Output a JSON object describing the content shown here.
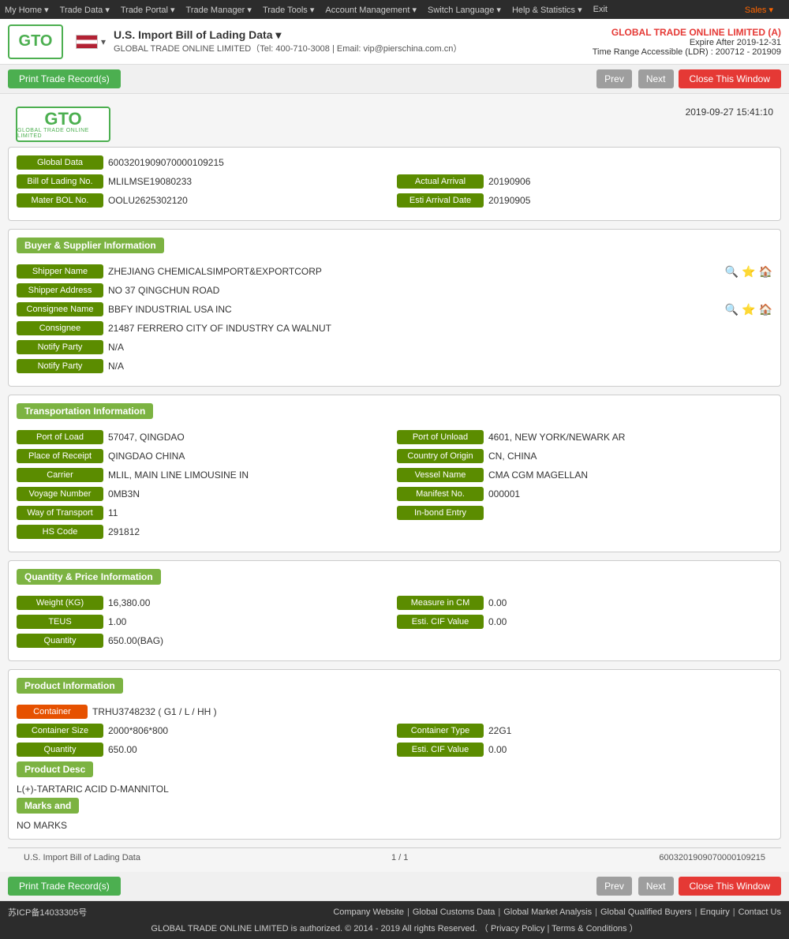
{
  "topnav": {
    "items": [
      "My Home ▾",
      "Trade Data ▾",
      "Trade Portal ▾",
      "Trade Manager ▾",
      "Trade Tools ▾",
      "Account Management ▾",
      "Switch Language ▾",
      "Help & Statistics ▾",
      "Exit"
    ],
    "sales": "Sales ▾"
  },
  "header": {
    "logo_text": "GTO",
    "logo_sub": "GLOBAL TRADE ONLINE LIMITED",
    "title": "U.S. Import Bill of Lading Data  ▾",
    "contact": "GLOBAL TRADE ONLINE LIMITED（Tel: 400-710-3008 | Email: vip@pierschina.com.cn）",
    "company": "GLOBAL TRADE ONLINE LIMITED (A)",
    "expire": "Expire After 2019-12-31",
    "time_range": "Time Range Accessible (LDR) : 200712 - 201909"
  },
  "toolbar": {
    "print_label": "Print Trade Record(s)",
    "prev_label": "Prev",
    "next_label": "Next",
    "close_label": "Close This Window"
  },
  "report": {
    "logo_text": "GTO",
    "logo_sub": "GLOBAL TRADE ONLINE LIMITED",
    "datetime": "2019-09-27 15:41:10",
    "global_data_label": "Global Data",
    "global_data_value": "6003201909070000109215",
    "bol_label": "Bill of Lading No.",
    "bol_value": "MLILMSE19080233",
    "actual_arrival_label": "Actual Arrival",
    "actual_arrival_value": "20190906",
    "mater_bol_label": "Mater BOL No.",
    "mater_bol_value": "OOLU2625302120",
    "esti_arrival_label": "Esti Arrival Date",
    "esti_arrival_value": "20190905",
    "buyer_supplier_header": "Buyer & Supplier Information",
    "shipper_name_label": "Shipper Name",
    "shipper_name_value": "ZHEJIANG CHEMICALSIMPORT&EXPORTCORP",
    "shipper_addr_label": "Shipper Address",
    "shipper_addr_value": "NO 37 QINGCHUN ROAD",
    "consignee_name_label": "Consignee Name",
    "consignee_name_value": "BBFY INDUSTRIAL USA INC",
    "consignee_label": "Consignee",
    "consignee_value": "21487 FERRERO CITY OF INDUSTRY CA WALNUT",
    "notify_party1_label": "Notify Party",
    "notify_party1_value": "N/A",
    "notify_party2_label": "Notify Party",
    "notify_party2_value": "N/A",
    "transport_header": "Transportation Information",
    "port_load_label": "Port of Load",
    "port_load_value": "57047, QINGDAO",
    "port_unload_label": "Port of Unload",
    "port_unload_value": "4601, NEW YORK/NEWARK AR",
    "place_receipt_label": "Place of Receipt",
    "place_receipt_value": "QINGDAO CHINA",
    "country_origin_label": "Country of Origin",
    "country_origin_value": "CN, CHINA",
    "carrier_label": "Carrier",
    "carrier_value": "MLIL, MAIN LINE LIMOUSINE IN",
    "vessel_name_label": "Vessel Name",
    "vessel_name_value": "CMA CGM MAGELLAN",
    "voyage_number_label": "Voyage Number",
    "voyage_number_value": "0MB3N",
    "manifest_no_label": "Manifest No.",
    "manifest_no_value": "000001",
    "way_transport_label": "Way of Transport",
    "way_transport_value": "11",
    "inbond_entry_label": "In-bond Entry",
    "inbond_entry_value": "",
    "hs_code_label": "HS Code",
    "hs_code_value": "291812",
    "quantity_header": "Quantity & Price Information",
    "weight_label": "Weight (KG)",
    "weight_value": "16,380.00",
    "measure_cm_label": "Measure in CM",
    "measure_cm_value": "0.00",
    "teus_label": "TEUS",
    "teus_value": "1.00",
    "esti_cif_label": "Esti. CIF Value",
    "esti_cif_value": "0.00",
    "quantity_label": "Quantity",
    "quantity_value": "650.00(BAG)",
    "product_header": "Product Information",
    "container_label": "Container",
    "container_value": "TRHU3748232 ( G1 / L / HH )",
    "container_size_label": "Container Size",
    "container_size_value": "2000*806*800",
    "container_type_label": "Container Type",
    "container_type_value": "22G1",
    "quantity2_label": "Quantity",
    "quantity2_value": "650.00",
    "esti_cif2_label": "Esti. CIF Value",
    "esti_cif2_value": "0.00",
    "product_desc_label": "Product Desc",
    "product_desc_value": "L(+)-TARTARIC ACID D-MANNITOL",
    "marks_label": "Marks and",
    "marks_value": "NO MARKS",
    "footer_source": "U.S. Import Bill of Lading Data",
    "footer_page": "1 / 1",
    "footer_id": "6003201909070000109215"
  },
  "page_footer": {
    "icp": "苏ICP备14033305号",
    "links": [
      "Company Website",
      "Global Customs Data",
      "Global Market Analysis",
      "Global Qualified Buyers",
      "Enquiry",
      "Contact Us"
    ],
    "copyright": "GLOBAL TRADE ONLINE LIMITED is authorized. © 2014 - 2019 All rights Reserved.  （ Privacy Policy | Terms & Conditions ）"
  }
}
